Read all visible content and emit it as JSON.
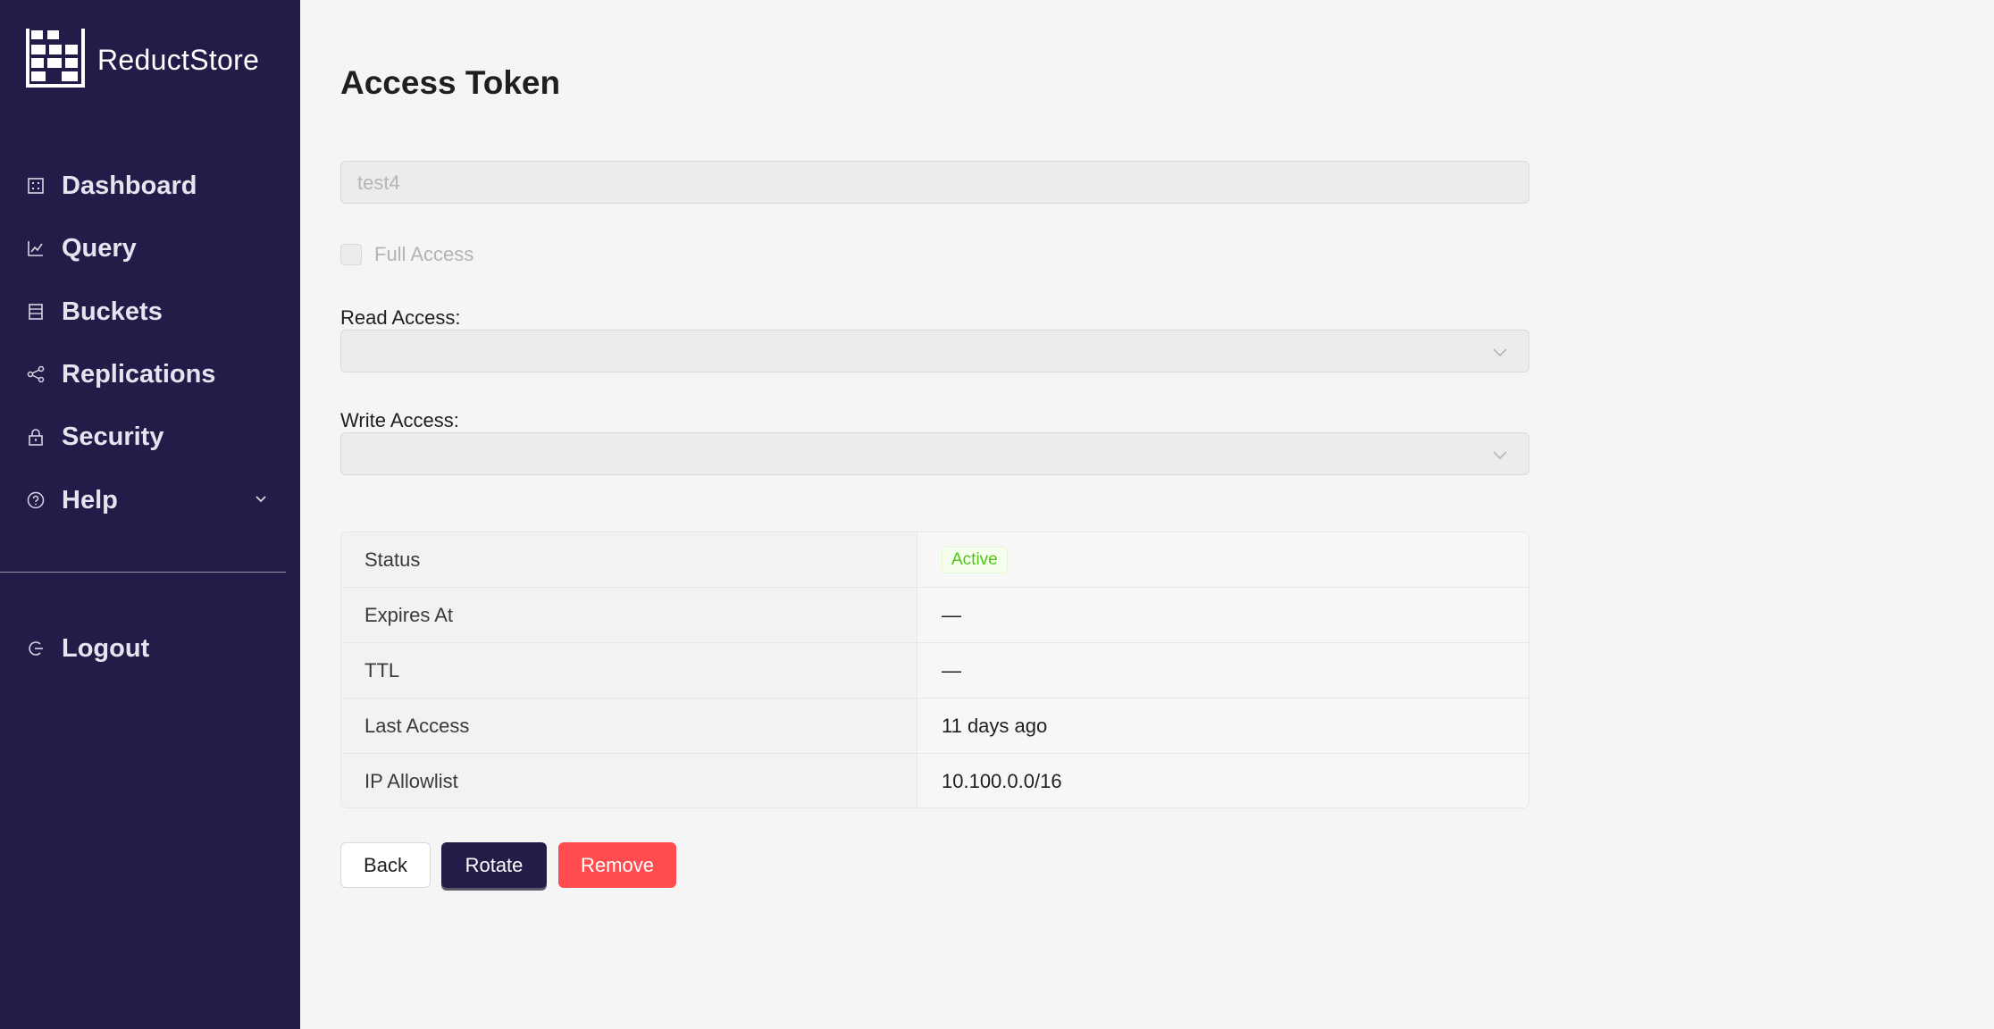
{
  "app": {
    "name": "ReductStore"
  },
  "sidebar": {
    "items": [
      {
        "label": "Dashboard",
        "icon": "dashboard-icon"
      },
      {
        "label": "Query",
        "icon": "line-chart-icon"
      },
      {
        "label": "Buckets",
        "icon": "database-icon"
      },
      {
        "label": "Replications",
        "icon": "share-icon"
      },
      {
        "label": "Security",
        "icon": "lock-icon"
      },
      {
        "label": "Help",
        "icon": "question-circle-icon"
      }
    ],
    "logout": {
      "label": "Logout",
      "icon": "logout-icon"
    }
  },
  "page": {
    "title": "Access Token",
    "token_name": "test4",
    "full_access_label": "Full Access",
    "full_access_checked": false,
    "read_access_label": "Read Access:",
    "read_access_value": "",
    "write_access_label": "Write Access:",
    "write_access_value": ""
  },
  "details": [
    {
      "key": "Status",
      "value": "Active",
      "badge": true
    },
    {
      "key": "Expires At",
      "value": "—"
    },
    {
      "key": "TTL",
      "value": "—"
    },
    {
      "key": "Last Access",
      "value": "11 days ago"
    },
    {
      "key": "IP Allowlist",
      "value": "10.100.0.0/16"
    }
  ],
  "actions": {
    "back": "Back",
    "rotate": "Rotate",
    "remove": "Remove"
  },
  "colors": {
    "sidebar": "#231c48",
    "primary": "#231c48",
    "danger": "#ff4d4f",
    "success": "#52c41a"
  }
}
